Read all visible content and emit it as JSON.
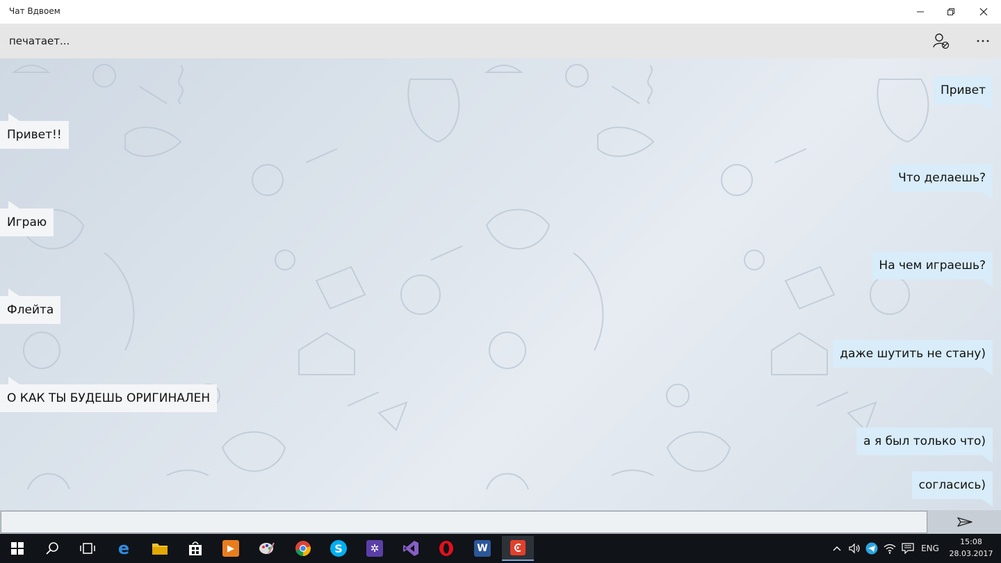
{
  "window": {
    "title": "Чат Вдвоем"
  },
  "header": {
    "status": "печатает..."
  },
  "messages": [
    {
      "side": "out",
      "text": "Привет"
    },
    {
      "side": "in",
      "text": "Привет!!"
    },
    {
      "side": "out",
      "text": "Что делаешь?"
    },
    {
      "side": "in",
      "text": "Играю"
    },
    {
      "side": "out",
      "text": "На чем играешь?"
    },
    {
      "side": "in",
      "text": "Флейта"
    },
    {
      "side": "out",
      "text": "даже шутить не стану)"
    },
    {
      "side": "in",
      "text": "О КАК ТЫ БУДЕШЬ ОРИГИНАЛЕН"
    },
    {
      "side": "out",
      "text": "а я был только что)"
    },
    {
      "side": "out",
      "text": "согласись)"
    }
  ],
  "input": {
    "value": "",
    "placeholder": ""
  },
  "taskbar": {
    "apps": [
      "start",
      "search",
      "task-view",
      "edge",
      "file-explorer",
      "store",
      "media-player",
      "paint",
      "chrome",
      "skype",
      "app-settings",
      "visual-studio",
      "opera",
      "word",
      "chat-app"
    ],
    "language": "ENG",
    "time": "15:08",
    "date": "28.03.2017"
  },
  "colors": {
    "incoming_bubble": "#f4f5f7",
    "outgoing_bubble": "#d8ecf9",
    "header_bg": "#e6e6e6",
    "taskbar_bg": "#101317"
  }
}
